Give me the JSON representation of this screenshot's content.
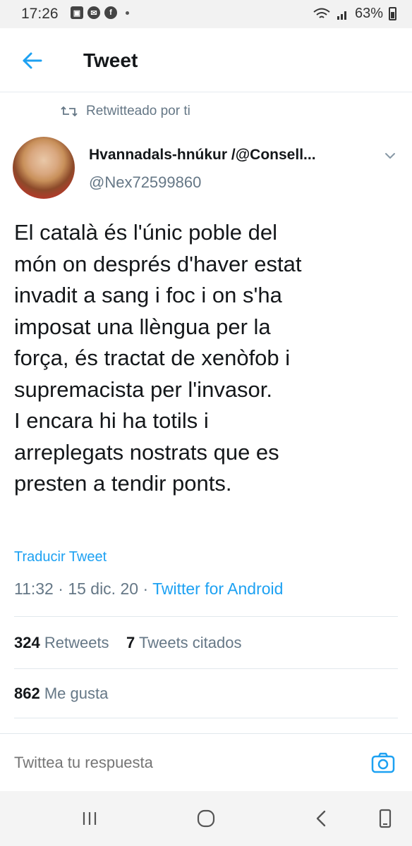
{
  "status_bar": {
    "time": "17:26",
    "battery": "63%",
    "icons": [
      "gallery-icon",
      "messenger-icon",
      "facebook-icon",
      "notification-dot"
    ]
  },
  "header": {
    "title": "Tweet",
    "back_icon": "arrow-left-icon"
  },
  "retweet_note": {
    "icon": "retweet-icon",
    "label": "Retwitteado por ti"
  },
  "author": {
    "name": "Hvannadals-hnúkur /@Consell...",
    "handle": "@Nex72599860"
  },
  "tweet": {
    "text": "El català és l'únic poble del\nmón on després d'haver estat\ninvadit a sang i foc i on s'ha\nimposat una llèngua per la\nforça, és tractat de xenòfob i\nsupremacista per l'invasor.\nI encara hi ha totils i\narreplegats nostrats que es\npresten a tendir ponts.",
    "translate_label": "Traducir Tweet",
    "time": "11:32",
    "date": "15 dic. 20",
    "source": "Twitter for Android"
  },
  "stats": {
    "retweets_count": "324",
    "retweets_label": "Retweets",
    "quotes_count": "7",
    "quotes_label": "Tweets citados",
    "likes_count": "862",
    "likes_label": "Me gusta"
  },
  "reply": {
    "placeholder": "Twittea tu respuesta",
    "camera_icon": "camera-icon"
  },
  "navbar": {
    "icons": [
      "recent-apps-icon",
      "home-icon",
      "back-icon",
      "rotate-icon"
    ]
  },
  "colors": {
    "accent": "#1da1f2",
    "secondary_text": "#657786",
    "primary_text": "#14171a"
  }
}
